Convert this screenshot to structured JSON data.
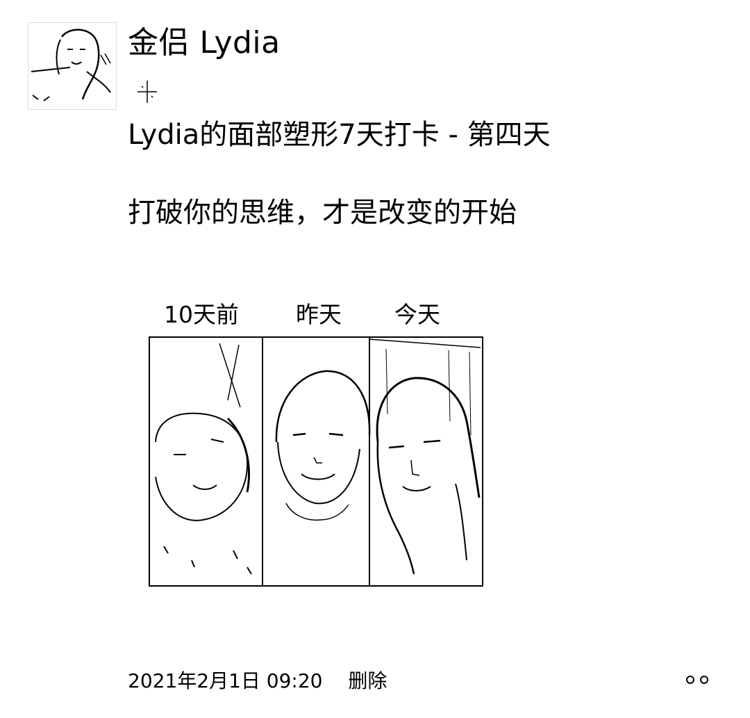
{
  "post": {
    "author_name": "金侣 Lydia",
    "lines": [
      "Lydia的面部塑形7天打卡 - 第四天",
      "打破你的思维，才是改变的开始"
    ],
    "photo_labels": [
      "10天前",
      "昨天",
      "今天"
    ],
    "timestamp": "2021年2月1日  09:20",
    "delete_label": "删除"
  },
  "icons": {
    "avatar": "avatar-photo",
    "sparkle": "sparkle-icon",
    "more": "more-options-icon"
  }
}
